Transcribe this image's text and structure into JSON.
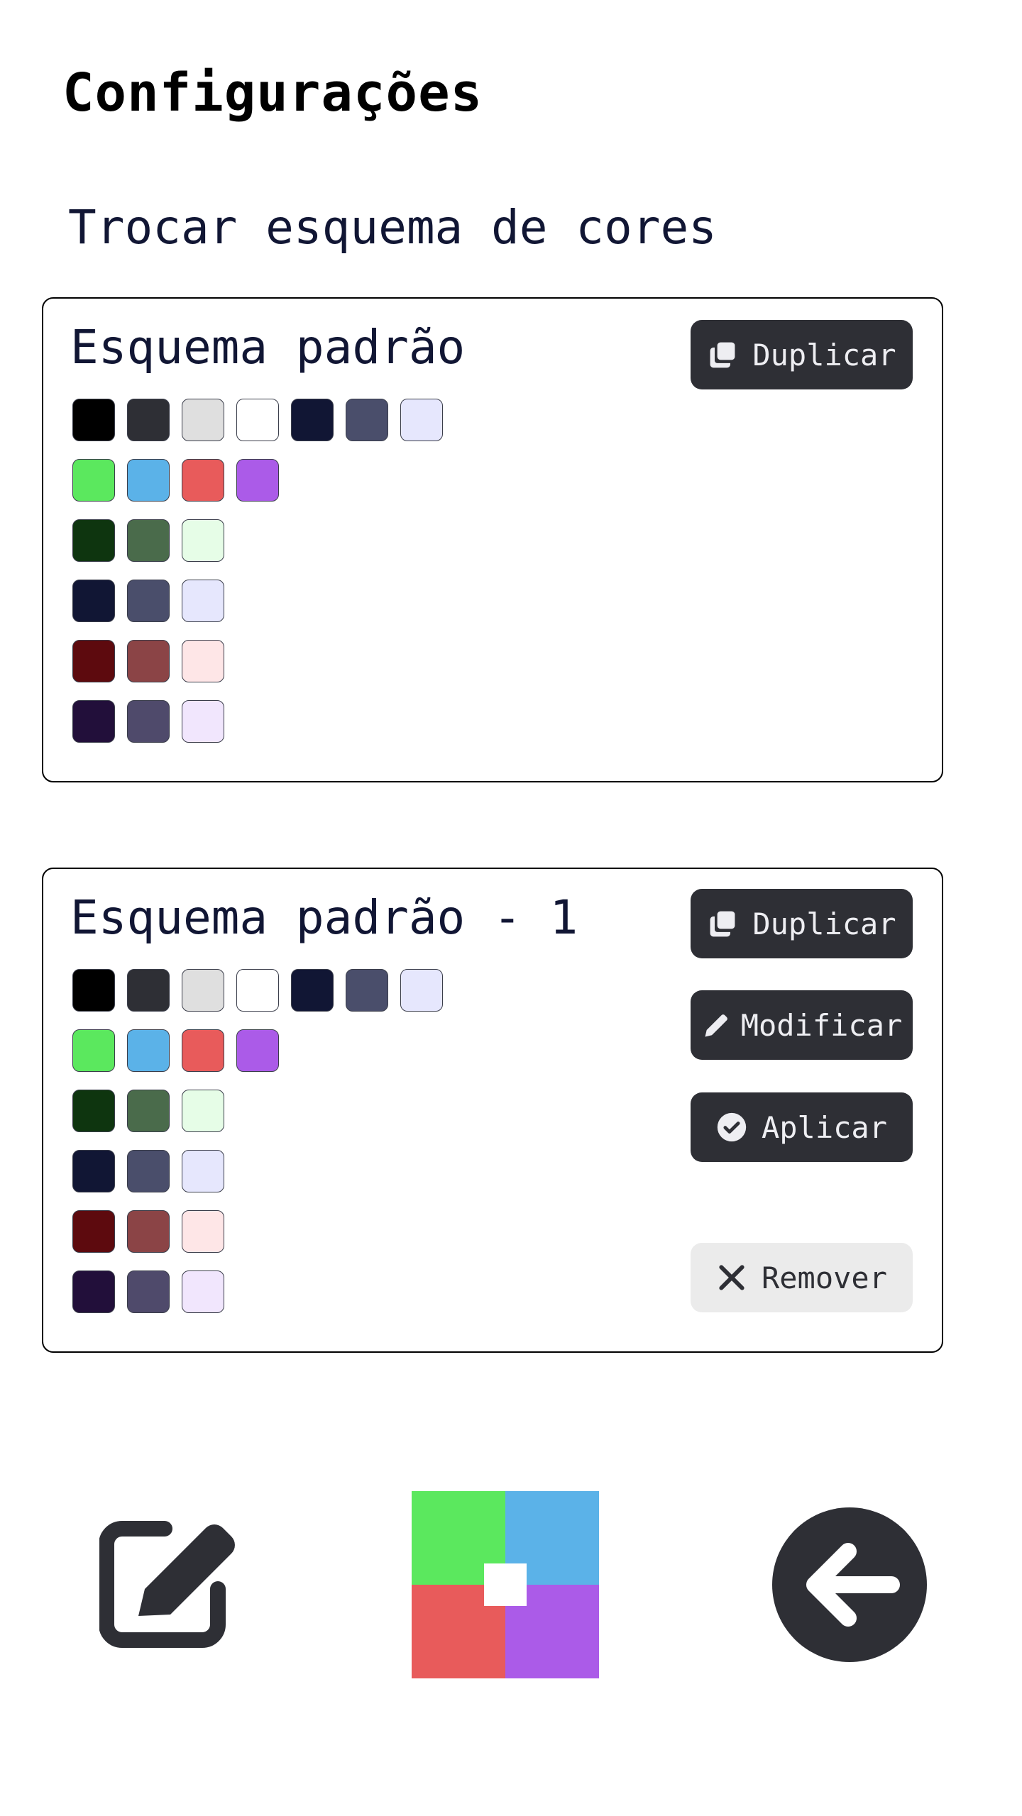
{
  "header": {
    "title": "Configurações"
  },
  "section": {
    "title": "Trocar esquema de cores"
  },
  "colors": {
    "base": [
      "#000000",
      "#2e2f35",
      "#dfdfdf",
      "#ffffff",
      "#111634",
      "#4a4e6b",
      "#e6e7fd"
    ],
    "accents": [
      "#5be85e",
      "#5bb2e8",
      "#e85b5b",
      "#ab5be8"
    ],
    "green": [
      "#0e350f",
      "#4a6b4b",
      "#e6fde7"
    ],
    "blue": [
      "#111634",
      "#4a4e6b",
      "#e6e7fd"
    ],
    "red": [
      "#5d0a0e",
      "#8b4446",
      "#fee6e7"
    ],
    "purple": [
      "#220f3a",
      "#4f4a6b",
      "#f1e6fd"
    ]
  },
  "schemes": [
    {
      "name": "Esquema padrão",
      "buttons": {
        "duplicate": "Duplicar"
      }
    },
    {
      "name": "Esquema padrão - 1",
      "buttons": {
        "duplicate": "Duplicar",
        "modify": "Modificar",
        "apply": "Aplicar",
        "remove": "Remover"
      }
    }
  ],
  "icons": {
    "duplicate": "copy-icon",
    "modify": "pencil-icon",
    "apply": "check-circle-icon",
    "remove": "x-icon",
    "edit_nav": "edit-icon",
    "back_nav": "arrow-left-circle-icon",
    "logo": "color-scheme-logo"
  }
}
